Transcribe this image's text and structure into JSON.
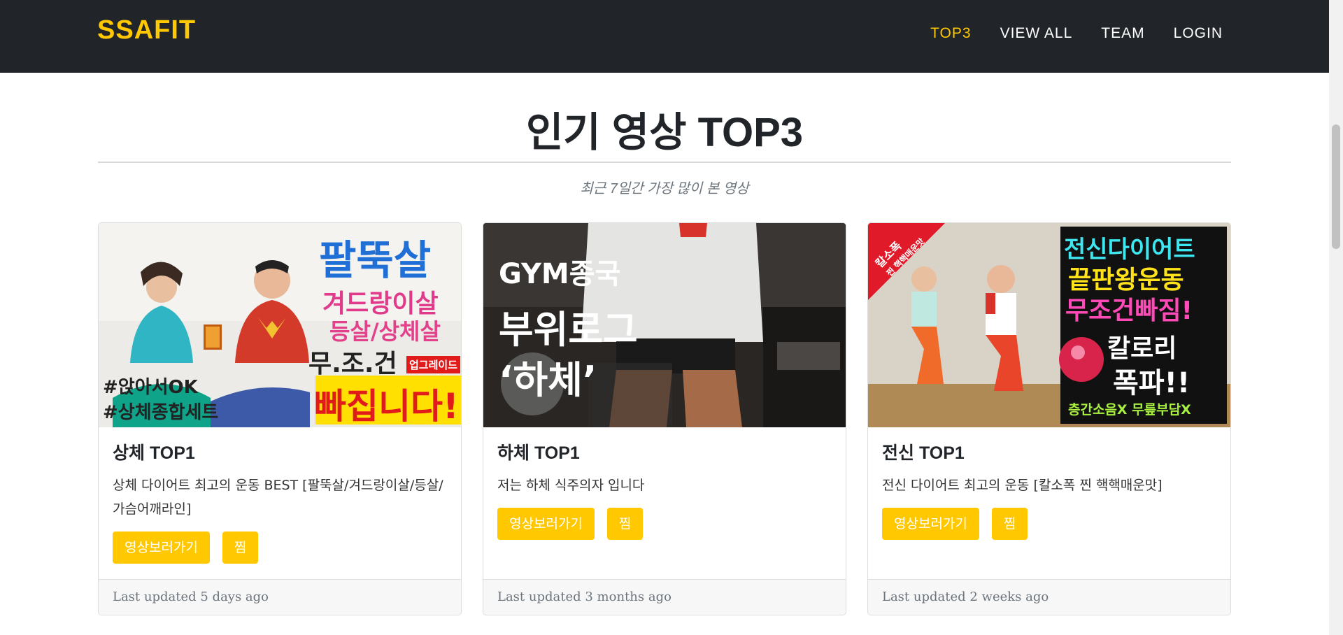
{
  "navbar": {
    "brand": "SSAFIT",
    "links": [
      {
        "label": "TOP3",
        "active": true
      },
      {
        "label": "VIEW ALL",
        "active": false
      },
      {
        "label": "TEAM",
        "active": false
      },
      {
        "label": "LOGIN",
        "active": false
      }
    ]
  },
  "section": {
    "title": "인기 영상 TOP3",
    "subtitle": "최근 7일간 가장 많이 본 영상"
  },
  "cards": [
    {
      "title": "상체 TOP1",
      "description": "상체 다이어트 최고의 운동 BEST [팔뚝살/겨드랑이살/등살/가슴어깨라인]",
      "watch_button": "영상보러가기",
      "like_button": "찜",
      "footer": "Last updated 5 days ago",
      "thumbnail": {
        "lines": [
          "팔뚝살",
          "겨드랑이살",
          "등살/상체살",
          "무.조.건",
          "빠집니다!",
          "#앉아서OK",
          "#상체종합세트",
          "업그레이드"
        ]
      }
    },
    {
      "title": "하체 TOP1",
      "description": "저는 하체 식주의자 입니다",
      "watch_button": "영상보러가기",
      "like_button": "찜",
      "footer": "Last updated 3 months ago",
      "thumbnail": {
        "lines": [
          "GYM종국",
          "부위로그",
          "‘하체’"
        ]
      }
    },
    {
      "title": "전신 TOP1",
      "description": "전신 다이어트 최고의 운동 [칼소폭 찐 핵핵매운맛]",
      "watch_button": "영상보러가기",
      "like_button": "찜",
      "footer": "Last updated 2 weeks ago",
      "thumbnail": {
        "lines": [
          "전신다이어트",
          "끝판왕운동",
          "무조건빠짐!",
          "칼로리",
          "폭파!!",
          "층간소음X 무릎부담X",
          "칼소폭",
          "찐 핵핵매운맛"
        ]
      }
    }
  ],
  "colors": {
    "accent": "#ffc800",
    "navbar_bg": "#212529"
  }
}
